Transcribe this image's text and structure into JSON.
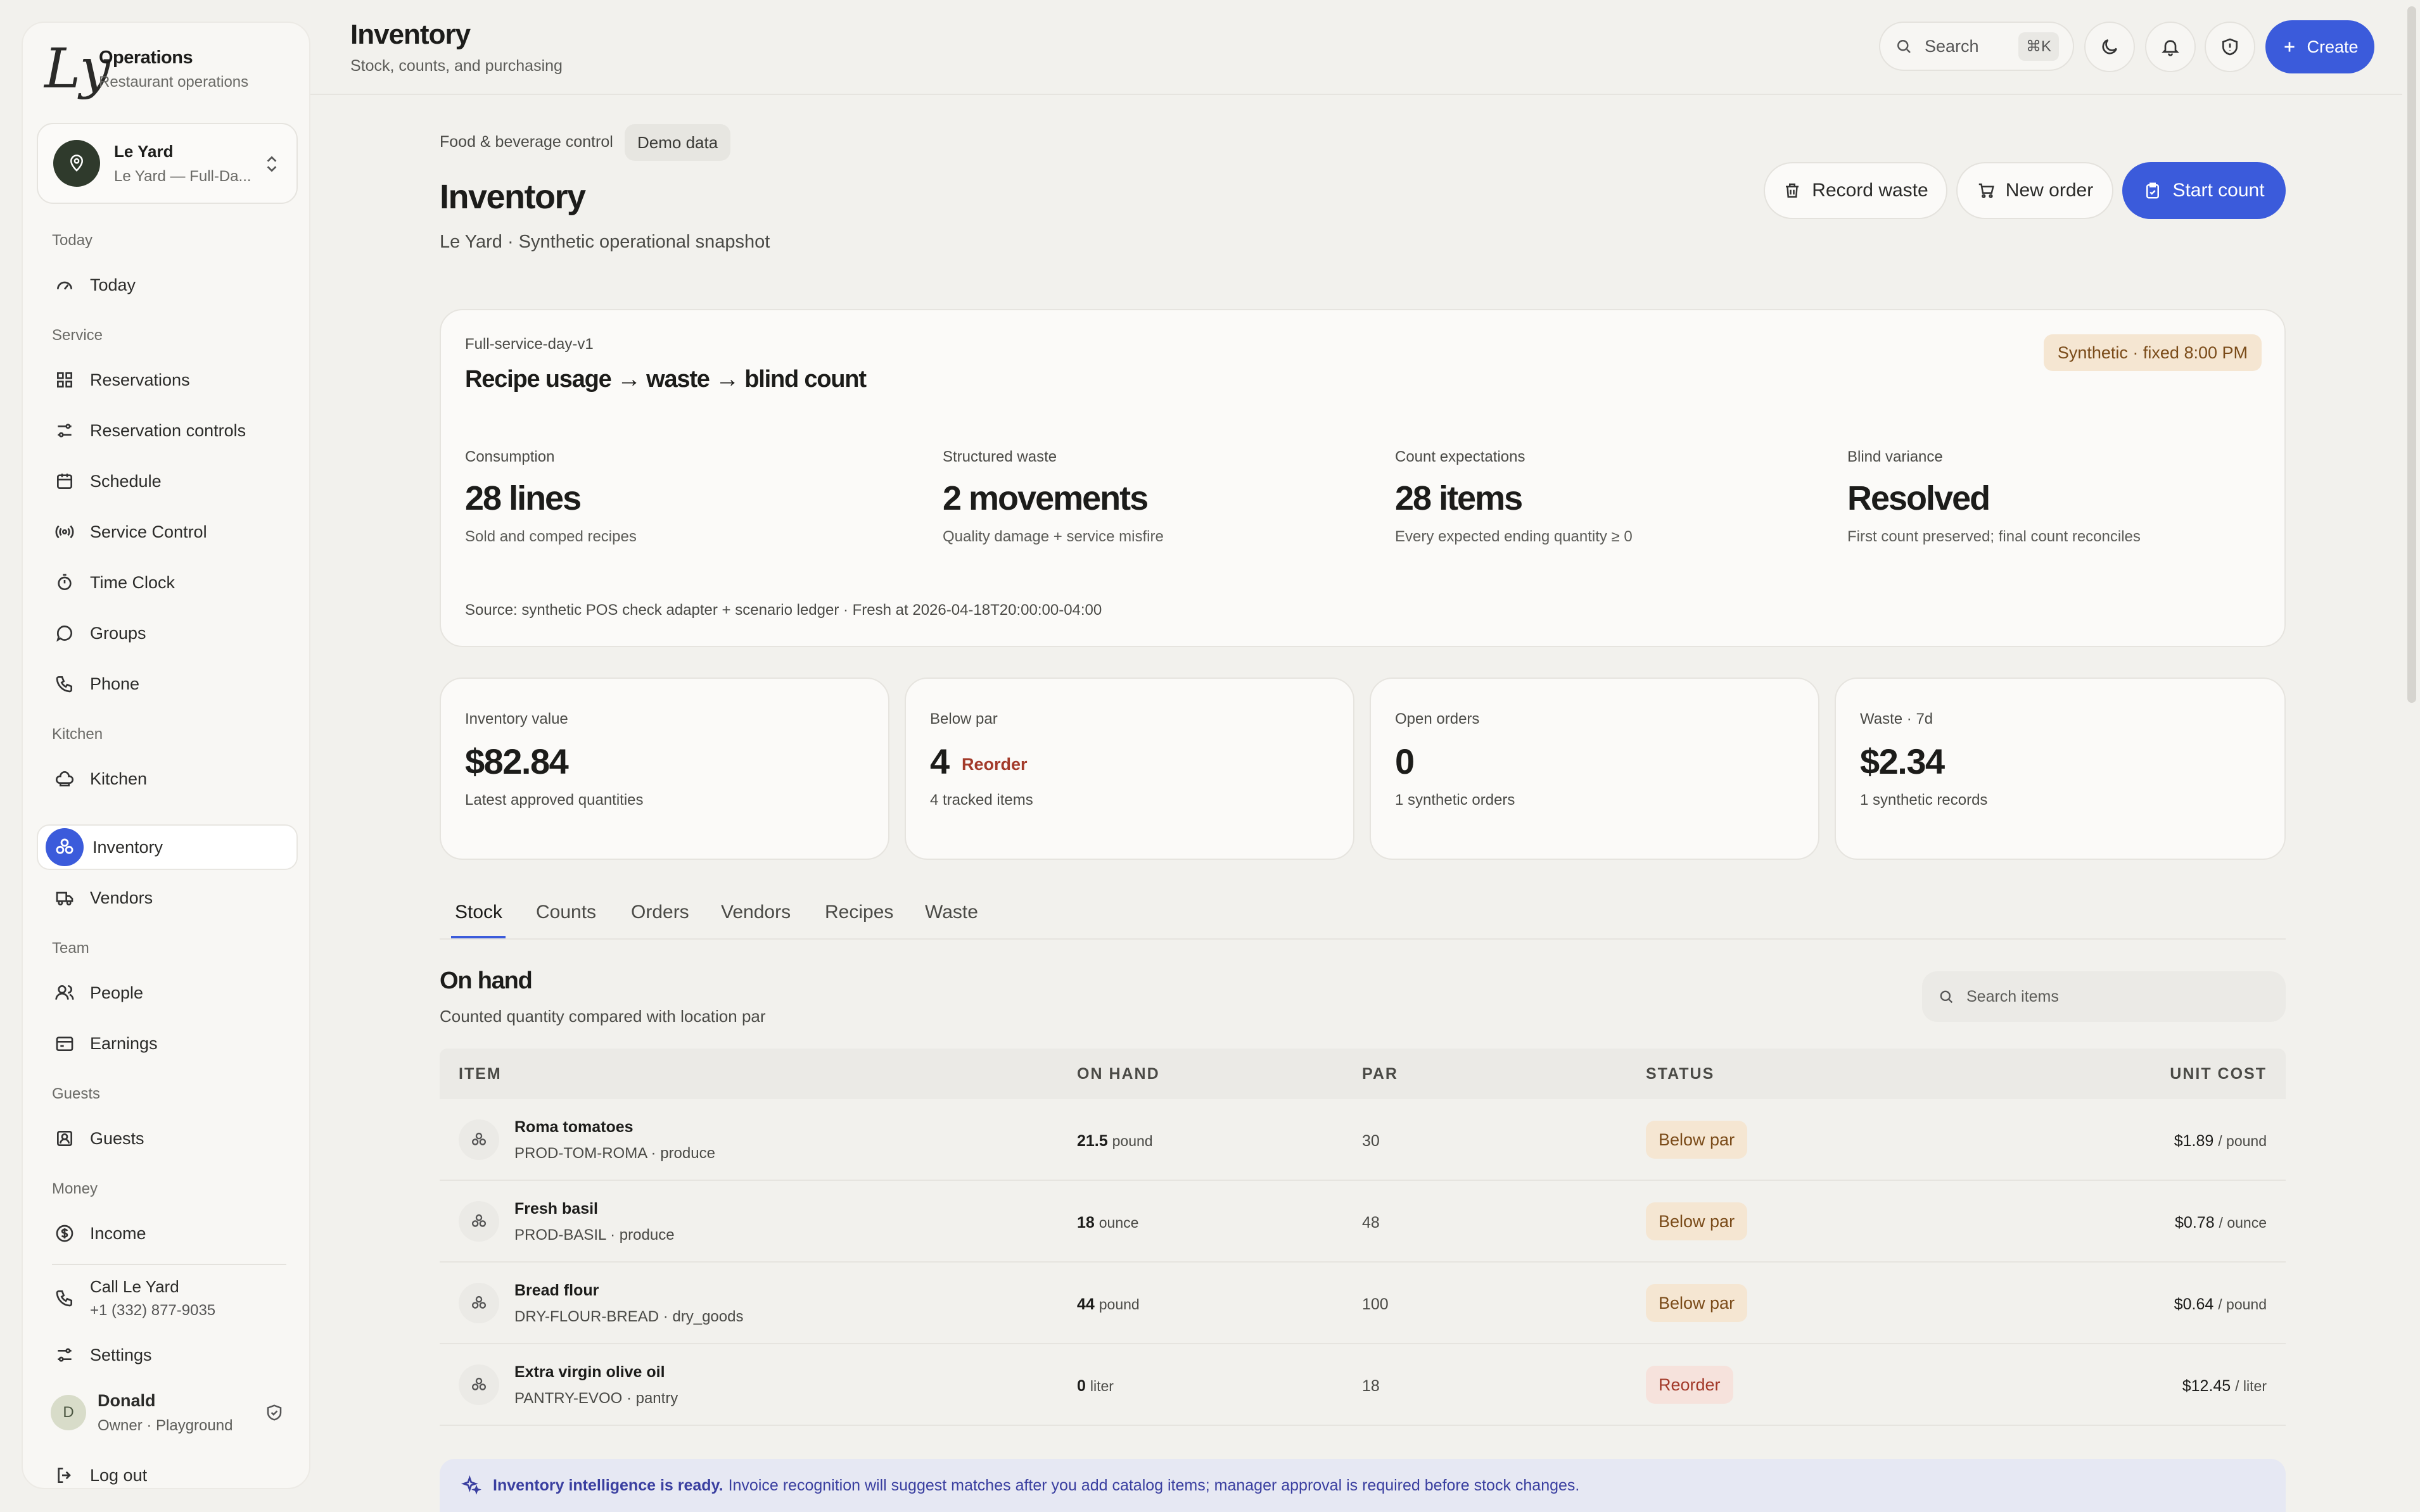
{
  "brand": {
    "logo": "Ly",
    "title": "Operations",
    "subtitle": "Restaurant operations"
  },
  "location": {
    "name": "Le Yard",
    "detail": "Le Yard — Full-Da..."
  },
  "nav": {
    "today_section": "Today",
    "today": "Today",
    "service_section": "Service",
    "reservations": "Reservations",
    "reservation_controls": "Reservation controls",
    "schedule": "Schedule",
    "service_control": "Service Control",
    "time_clock": "Time Clock",
    "groups": "Groups",
    "phone": "Phone",
    "kitchen_section": "Kitchen",
    "kitchen": "Kitchen",
    "inventory": "Inventory",
    "vendors": "Vendors",
    "team_section": "Team",
    "people": "People",
    "earnings": "Earnings",
    "guests_section": "Guests",
    "guests": "Guests",
    "money_section": "Money",
    "income": "Income",
    "call_label": "Call Le Yard",
    "call_number": "+1 (332) 877-9035",
    "settings": "Settings",
    "user_initial": "D",
    "user_name": "Donald",
    "user_role": "Owner · Playground",
    "logout": "Log out"
  },
  "header": {
    "title": "Inventory",
    "subtitle": "Stock, counts, and purchasing",
    "search_label": "Search",
    "search_shortcut": "⌘K",
    "create_label": "Create"
  },
  "page": {
    "breadcrumb": "Food & beverage control",
    "demo_chip": "Demo data",
    "title": "Inventory",
    "subtitle": "Le Yard · Synthetic operational snapshot",
    "actions": {
      "record_waste": "Record waste",
      "new_order": "New order",
      "start_count": "Start count"
    }
  },
  "scenario": {
    "id": "Full-service-day-v1",
    "title": "Recipe usage → waste → blind count",
    "badge": "Synthetic · fixed 8:00 PM",
    "metrics": [
      {
        "label": "Consumption",
        "value": "28 lines",
        "desc": "Sold and comped recipes"
      },
      {
        "label": "Structured waste",
        "value": "2 movements",
        "desc": "Quality damage + service misfire"
      },
      {
        "label": "Count expectations",
        "value": "28 items",
        "desc": "Every expected ending quantity ≥ 0"
      },
      {
        "label": "Blind variance",
        "value": "Resolved",
        "desc": "First count preserved; final count reconciles"
      }
    ],
    "source": "Source: synthetic POS check adapter + scenario ledger · Fresh at 2026-04-18T20:00:00-04:00"
  },
  "kpis": [
    {
      "label": "Inventory value",
      "value": "$82.84",
      "tag": "",
      "desc": "Latest approved quantities"
    },
    {
      "label": "Below par",
      "value": "4",
      "tag": "Reorder",
      "desc": "4 tracked items"
    },
    {
      "label": "Open orders",
      "value": "0",
      "tag": "",
      "desc": "1 synthetic orders"
    },
    {
      "label": "Waste · 7d",
      "value": "$2.34",
      "tag": "",
      "desc": "1 synthetic records"
    }
  ],
  "tabs": [
    "Stock",
    "Counts",
    "Orders",
    "Vendors",
    "Recipes",
    "Waste"
  ],
  "onhand": {
    "title": "On hand",
    "subtitle": "Counted quantity compared with location par",
    "search_placeholder": "Search items"
  },
  "table": {
    "headers": [
      "ITEM",
      "ON HAND",
      "PAR",
      "STATUS",
      "UNIT COST"
    ],
    "rows": [
      {
        "name": "Roma tomatoes",
        "sku": "PROD-TOM-ROMA · produce",
        "qty": "21.5",
        "unit": "pound",
        "par": "30",
        "status": "Below par",
        "cost": "$1.89",
        "cost_unit": "/ pound"
      },
      {
        "name": "Fresh basil",
        "sku": "PROD-BASIL · produce",
        "qty": "18",
        "unit": "ounce",
        "par": "48",
        "status": "Below par",
        "cost": "$0.78",
        "cost_unit": "/ ounce"
      },
      {
        "name": "Bread flour",
        "sku": "DRY-FLOUR-BREAD · dry_goods",
        "qty": "44",
        "unit": "pound",
        "par": "100",
        "status": "Below par",
        "cost": "$0.64",
        "cost_unit": "/ pound"
      },
      {
        "name": "Extra virgin olive oil",
        "sku": "PANTRY-EVOO · pantry",
        "qty": "0",
        "unit": "liter",
        "par": "18",
        "status": "Reorder",
        "cost": "$12.45",
        "cost_unit": "/ liter"
      }
    ]
  },
  "banner": {
    "bold": "Inventory intelligence is ready.",
    "text": "Invoice recognition will suggest matches after you add catalog items; manager approval is required before stock changes."
  },
  "colors": {
    "accent": "#3b5bdb",
    "below_par_bg": "#f5e6d2",
    "reorder_text": "#a33a2a"
  }
}
